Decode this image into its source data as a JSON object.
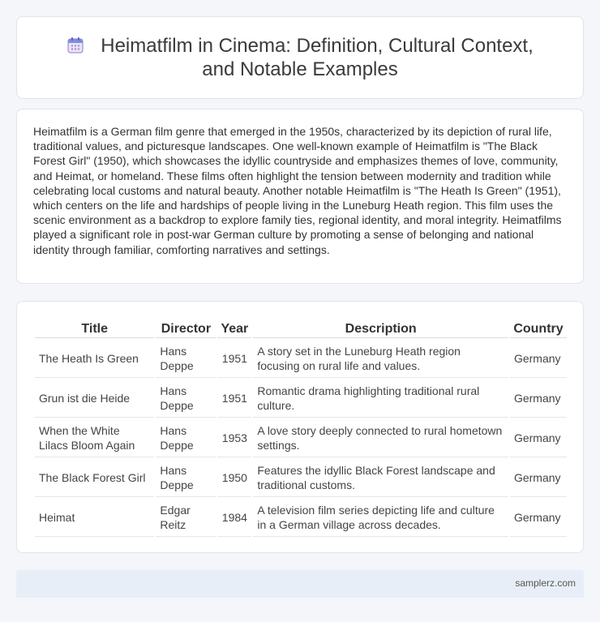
{
  "header": {
    "icon": "calendar-icon",
    "title": "Heimatfilm in Cinema: Definition, Cultural Context, and Notable Examples"
  },
  "intro": {
    "text": "Heimatfilm is a German film genre that emerged in the 1950s, characterized by its depiction of rural life, traditional values, and picturesque landscapes. One well-known example of Heimatfilm is \"The Black Forest Girl\" (1950), which showcases the idyllic countryside and emphasizes themes of love, community, and Heimat, or homeland. These films often highlight the tension between modernity and tradition while celebrating local customs and natural beauty. Another notable Heimatfilm is \"The Heath Is Green\" (1951), which centers on the life and hardships of people living in the Luneburg Heath region. This film uses the scenic environment as a backdrop to explore family ties, regional identity, and moral integrity. Heimatfilms played a significant role in post-war German culture by promoting a sense of belonging and national identity through familiar, comforting narratives and settings."
  },
  "table": {
    "headers": [
      "Title",
      "Director",
      "Year",
      "Description",
      "Country"
    ],
    "rows": [
      {
        "title": "The Heath Is Green",
        "director": "Hans Deppe",
        "year": "1951",
        "description": "A story set in the Luneburg Heath region focusing on rural life and values.",
        "country": "Germany"
      },
      {
        "title": "Grun ist die Heide",
        "director": "Hans Deppe",
        "year": "1951",
        "description": "Romantic drama highlighting traditional rural culture.",
        "country": "Germany"
      },
      {
        "title": "When the White Lilacs Bloom Again",
        "director": "Hans Deppe",
        "year": "1953",
        "description": "A love story deeply connected to rural hometown settings.",
        "country": "Germany"
      },
      {
        "title": "The Black Forest Girl",
        "director": "Hans Deppe",
        "year": "1950",
        "description": "Features the idyllic Black Forest landscape and traditional customs.",
        "country": "Germany"
      },
      {
        "title": "Heimat",
        "director": "Edgar Reitz",
        "year": "1984",
        "description": "A television film series depicting life and culture in a German village across decades.",
        "country": "Germany"
      }
    ]
  },
  "footer": {
    "site": "samplerz.com"
  }
}
